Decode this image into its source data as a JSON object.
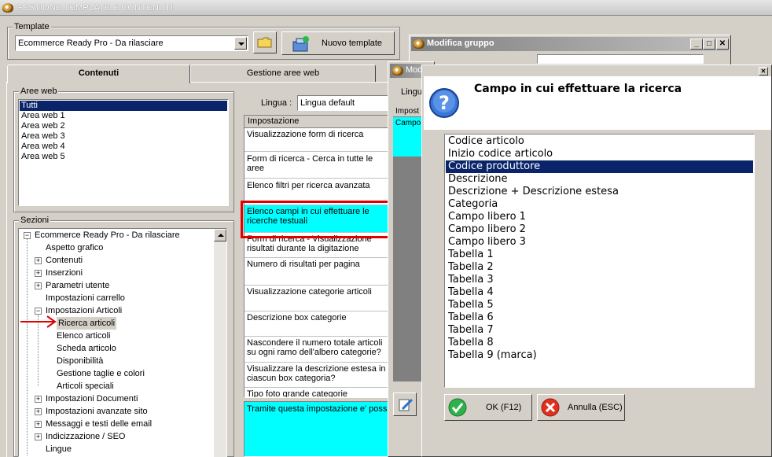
{
  "window": {
    "title": "GESTIONE TEMPLATE E CONTENUTI"
  },
  "template": {
    "group_label": "Template",
    "selected": "Ecommerce Ready Pro - Da rilasciare",
    "new_button": "Nuovo template"
  },
  "tabs": [
    {
      "label": "Contenuti",
      "active": true
    },
    {
      "label": "Gestione aree web",
      "active": false
    }
  ],
  "aree_web": {
    "label": "Aree web",
    "items": [
      "Tutti",
      "Area web 1",
      "Area web 2",
      "Area web 3",
      "Area web 4",
      "Area web 5"
    ],
    "selected_index": 0
  },
  "sezioni": {
    "label": "Sezioni",
    "tree": [
      {
        "label": "Ecommerce Ready Pro - Da rilasciare",
        "level": 0,
        "expander": "-"
      },
      {
        "label": "Aspetto grafico",
        "level": 1,
        "expander": ""
      },
      {
        "label": "Contenuti",
        "level": 1,
        "expander": "+"
      },
      {
        "label": "Inserzioni",
        "level": 1,
        "expander": "+"
      },
      {
        "label": "Parametri utente",
        "level": 1,
        "expander": "+"
      },
      {
        "label": "Impostazioni carrello",
        "level": 1,
        "expander": ""
      },
      {
        "label": "Impostazioni Articoli",
        "level": 1,
        "expander": "-"
      },
      {
        "label": "Ricerca articoli",
        "level": 2,
        "expander": "",
        "selected": true
      },
      {
        "label": "Elenco articoli",
        "level": 2,
        "expander": ""
      },
      {
        "label": "Scheda articolo",
        "level": 2,
        "expander": ""
      },
      {
        "label": "Disponibilità",
        "level": 2,
        "expander": ""
      },
      {
        "label": "Gestione taglie e colori",
        "level": 2,
        "expander": ""
      },
      {
        "label": "Articoli speciali",
        "level": 2,
        "expander": ""
      },
      {
        "label": "Impostazioni Documenti",
        "level": 1,
        "expander": "+"
      },
      {
        "label": "Impostazioni avanzate sito",
        "level": 1,
        "expander": "+"
      },
      {
        "label": "Messaggi e testi delle email",
        "level": 1,
        "expander": "+"
      },
      {
        "label": "Indicizzazione / SEO",
        "level": 1,
        "expander": "+"
      },
      {
        "label": "Lingue",
        "level": 1,
        "expander": ""
      }
    ]
  },
  "lingua": {
    "label": "Lingua :",
    "value": "Lingua default"
  },
  "grid": {
    "header": "Impostazione",
    "rows": [
      "Visualizzazione form di ricerca",
      "Form di ricerca - Cerca in tutte le aree",
      "Elenco filtri per ricerca avanzata",
      "Elenco campi in cui effettuare le ricerche testuali",
      "Form di ricerca - Visualizzazione risultati durante la digitazione",
      "Numero di risultati per pagina",
      "Visualizzazione categorie articoli",
      "Descrizione box categorie",
      "Nascondere il numero totale articoli su ogni ramo dell'albero categorie?",
      "Visualizzare la descrizione estesa in ciascun box categoria?",
      "Tipo foto grande categorie"
    ],
    "highlighted_index": 3
  },
  "description_text": "Tramite questa impostazione e' possibile",
  "modifica_gruppo": {
    "title": "Modifica gruppo"
  },
  "mod_window": {
    "title": "Mod",
    "lingua_label": "Lingu",
    "col_header": "Impost",
    "cell": "Campo"
  },
  "dialog": {
    "title": "Campo in cui effettuare la ricerca",
    "options": [
      "Codice articolo",
      "Inizio codice articolo",
      "Codice produttore",
      "Descrizione",
      "Descrizione + Descrizione estesa",
      "Categoria",
      "Campo libero 1",
      "Campo libero 2",
      "Campo libero 3",
      "Tabella 1",
      "Tabella 2",
      "Tabella 3",
      "Tabella 4",
      "Tabella 5",
      "Tabella 6",
      "Tabella 7",
      "Tabella 8",
      "Tabella 9 (marca)"
    ],
    "selected_index": 2,
    "ok_label": "OK (F12)",
    "cancel_label": "Annulla (ESC)"
  },
  "colors": {
    "selection": "#0a246a",
    "highlight_cyan": "#00ffff",
    "annotation_red": "#e00000"
  }
}
